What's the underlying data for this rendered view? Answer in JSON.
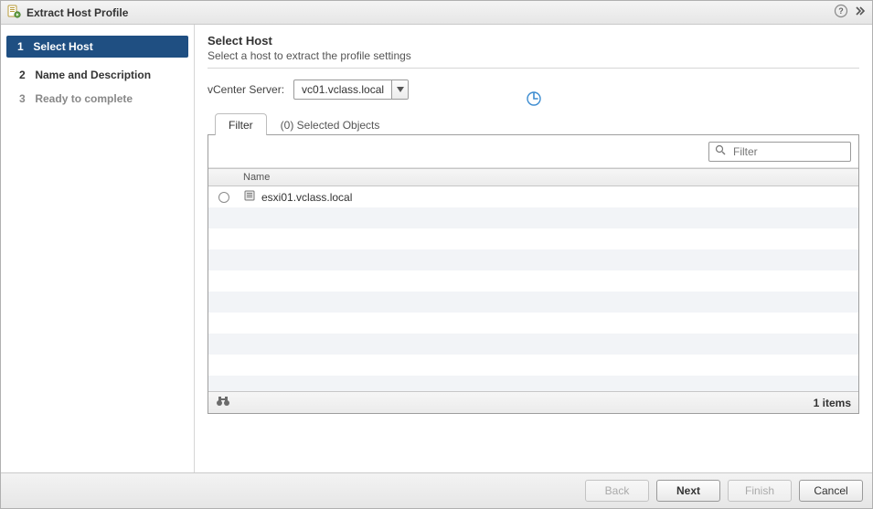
{
  "dialog": {
    "title": "Extract Host Profile"
  },
  "wizard": {
    "steps": [
      {
        "num": "1",
        "label": "Select Host",
        "state": "active"
      },
      {
        "num": "2",
        "label": "Name and Description",
        "state": "pending"
      },
      {
        "num": "3",
        "label": "Ready to complete",
        "state": "future"
      }
    ]
  },
  "page": {
    "heading": "Select Host",
    "subheading": "Select a host to extract the profile settings",
    "vcenter_label": "vCenter Server:",
    "vcenter_value": "vc01.vclass.local"
  },
  "tabs": {
    "filter": "Filter",
    "selected": "(0) Selected Objects"
  },
  "grid": {
    "filter_placeholder": "Filter",
    "columns": {
      "name": "Name"
    },
    "rows": [
      {
        "name": "esxi01.vclass.local"
      }
    ],
    "footer_count": "1 items"
  },
  "buttons": {
    "back": "Back",
    "next": "Next",
    "finish": "Finish",
    "cancel": "Cancel"
  }
}
